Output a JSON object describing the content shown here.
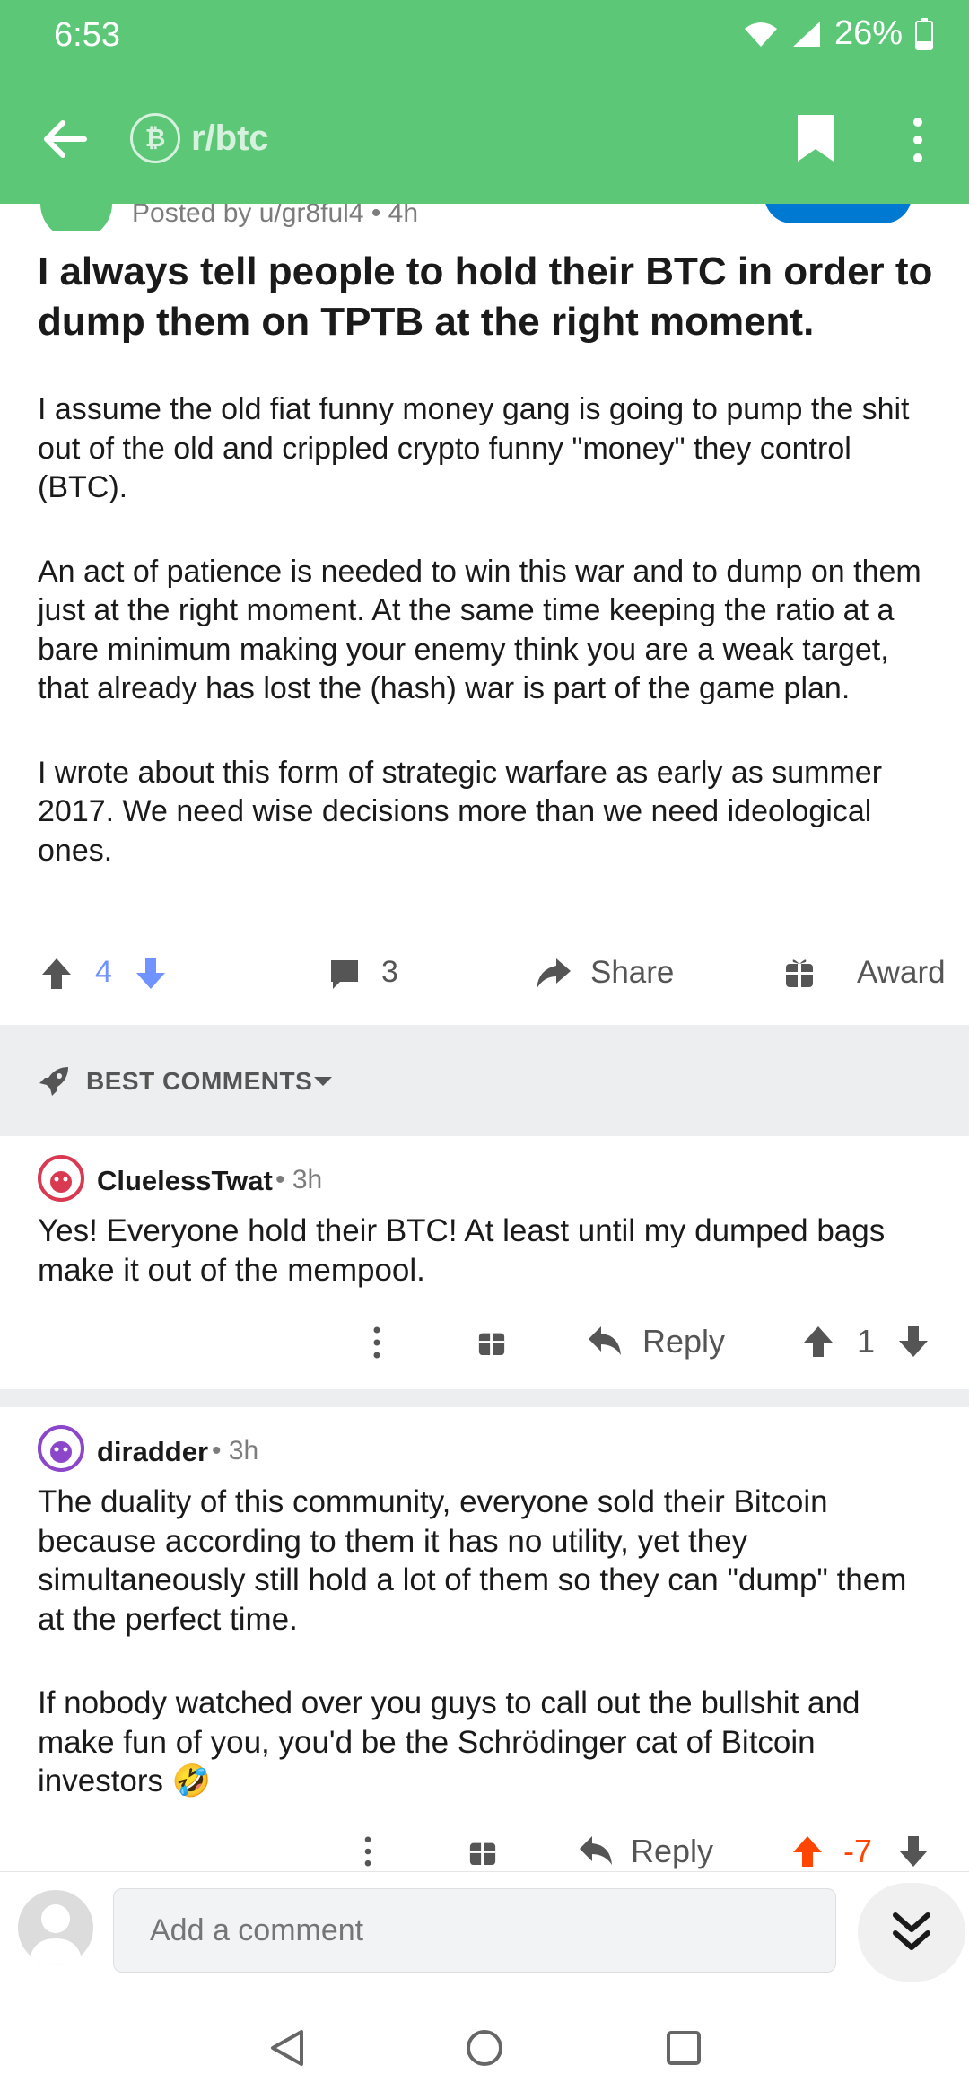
{
  "status_bar": {
    "time": "6:53",
    "battery": "26%"
  },
  "header": {
    "subreddit": "r/btc",
    "coin_symbol": "₿"
  },
  "post": {
    "meta": "Posted by u/gr8ful4 • 4h",
    "title": "I always tell people to hold their BTC in order to dump them on TPTB at the right moment.",
    "body": [
      "I assume the old fiat funny money gang is going to pump the shit out of the old and crippled crypto funny \"money\" they control (BTC).",
      "An act of patience is needed to win this war and to dump on them just at the right moment. At the same time keeping the ratio at a bare minimum making your enemy think you are a weak target, that already has lost the (hash) war is part of the game plan.",
      "I wrote about this form of strategic warfare as early as summer 2017. We need wise decisions more than we need ideological ones."
    ],
    "votes": "4",
    "comments": "3",
    "share_label": "Share",
    "award_label": "Award"
  },
  "sort": {
    "label": "BEST COMMENTS"
  },
  "comments": [
    {
      "user": "CluelessTwat",
      "time": "• 3h",
      "body": [
        "Yes! Everyone hold their BTC! At least until my dumped bags make it out of the mempool."
      ],
      "reply_label": "Reply",
      "score": "1"
    },
    {
      "user": "diradder",
      "time": "• 3h",
      "body": [
        "The duality of this community, everyone sold their Bitcoin because according to them it has no utility, yet they simultaneously still hold a lot of them so they can \"dump\" them at the perfect time.",
        "If nobody watched over you guys to call out the bullshit and make fun of you, you'd be the Schrödinger cat of Bitcoin investors"
      ],
      "emoji": "🤣",
      "reply_label": "Reply",
      "score": "-7"
    }
  ],
  "composer": {
    "placeholder": "Add a comment"
  },
  "colors": {
    "header": "#5cc877",
    "upvote_blue": "#7193ff",
    "upvote_orange": "#ff4500",
    "divider": "#edeef0"
  }
}
